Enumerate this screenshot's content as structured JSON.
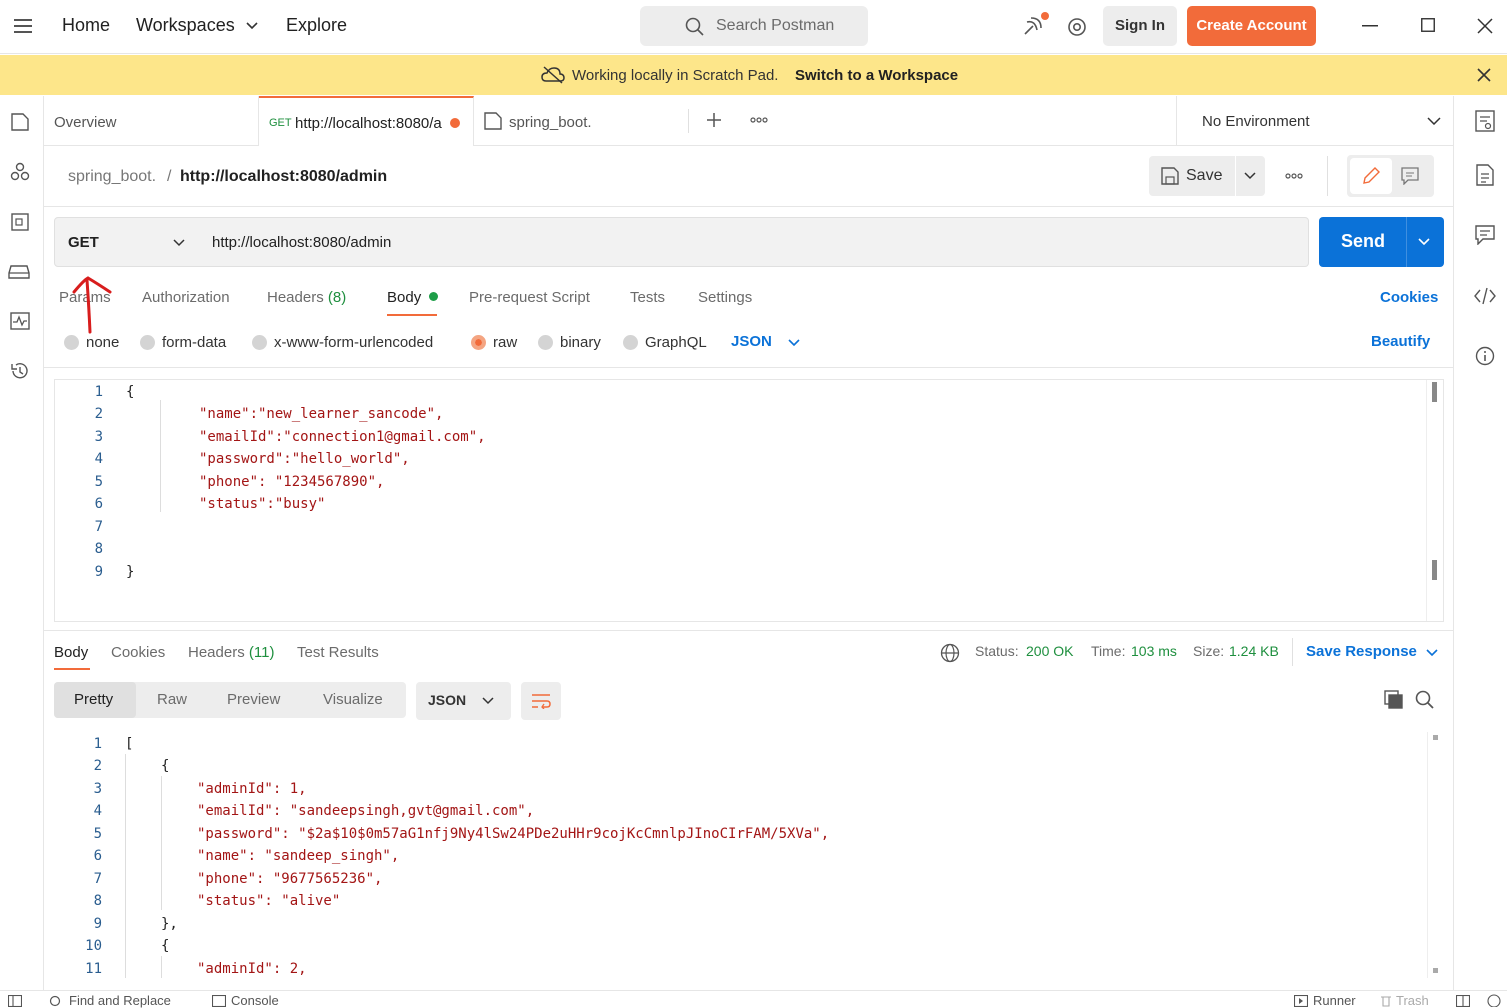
{
  "topbar": {
    "nav": [
      "Home",
      "Workspaces",
      "Explore"
    ],
    "search_placeholder": "Search Postman",
    "sign_in": "Sign In",
    "create_account": "Create Account"
  },
  "banner": {
    "text": "Working locally in Scratch Pad.",
    "link": "Switch to a Workspace"
  },
  "tabs": {
    "overview": "Overview",
    "active_method": "GET",
    "active_label": "http://localhost:8080/a",
    "third": "spring_boot.",
    "environment": "No Environment"
  },
  "breadcrumb": {
    "collection": "spring_boot.",
    "separator": "/",
    "request": "http://localhost:8080/admin"
  },
  "save": "Save",
  "request": {
    "method": "GET",
    "url": "http://localhost:8080/admin",
    "send": "Send",
    "tabs": [
      "Params",
      "Authorization",
      "Headers",
      "Body",
      "Pre-request Script",
      "Tests",
      "Settings"
    ],
    "headers_count": "(8)",
    "cookies": "Cookies",
    "body_types": [
      "none",
      "form-data",
      "x-www-form-urlencoded",
      "raw",
      "binary",
      "GraphQL"
    ],
    "selected_body_type": "raw",
    "format": "JSON",
    "beautify": "Beautify",
    "body_lines": [
      "{",
      "\"name\":\"new_learner_sancode\",",
      "\"emailId\":\"connection1@gmail.com\",",
      "\"password\":\"hello_world\",",
      "\"phone\": \"1234567890\",",
      "\"status\":\"busy\"",
      "",
      "",
      "}"
    ]
  },
  "response": {
    "tabs": [
      "Body",
      "Cookies",
      "Headers",
      "Test Results"
    ],
    "headers_count": "(11)",
    "status_label": "Status:",
    "status_value": "200 OK",
    "time_label": "Time:",
    "time_value": "103 ms",
    "size_label": "Size:",
    "size_value": "1.24 KB",
    "save_response": "Save Response",
    "view_modes": [
      "Pretty",
      "Raw",
      "Preview",
      "Visualize"
    ],
    "format": "JSON",
    "lines": [
      "[",
      "{",
      "\"adminId\": 1,",
      "\"emailId\": \"sandeepsingh,gvt@gmail.com\",",
      "\"password\": \"$2a$10$0m57aG1nfj9Ny4lSw24PDe2uHHr9cojKcCmnlpJInoCIrFAM/5XVa\",",
      "\"name\": \"sandeep_singh\",",
      "\"phone\": \"9677565236\",",
      "\"status\": \"alive\"",
      "},",
      "{",
      "\"adminId\": 2,"
    ]
  },
  "bottom": {
    "find_replace": "Find and Replace",
    "console": "Console",
    "runner": "Runner",
    "trash": "Trash"
  }
}
